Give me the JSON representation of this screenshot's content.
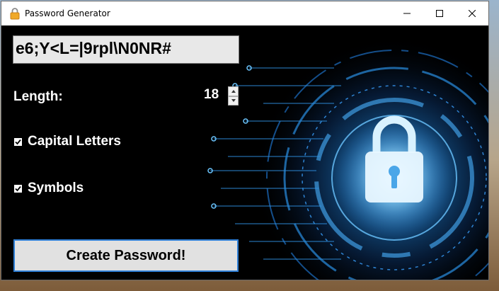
{
  "window": {
    "title": "Password Generator",
    "icon": "padlock-icon"
  },
  "password": {
    "value": "e6;Y<L=|9rpl\\N0NR#"
  },
  "length": {
    "label": "Length:",
    "value": "18"
  },
  "options": {
    "capital_letters": {
      "label": "Capital Letters",
      "checked": true
    },
    "symbols": {
      "label": "Symbols",
      "checked": true
    }
  },
  "actions": {
    "create_label": "Create Password!"
  },
  "colors": {
    "button_border": "#2f7fd6",
    "glow": "#3fa6ff"
  }
}
